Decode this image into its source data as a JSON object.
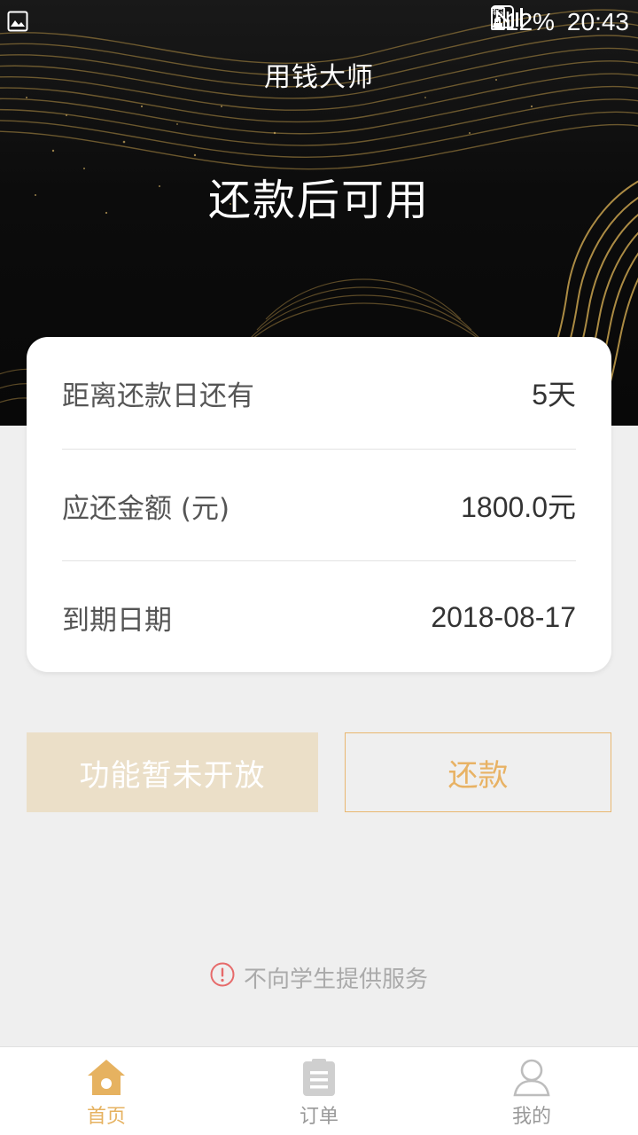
{
  "status_bar": {
    "battery_percent": "12%",
    "time": "20:43",
    "network": "4G",
    "icons": [
      "gallery-icon",
      "nfc-icon",
      "signal-icon",
      "battery-charging-icon"
    ]
  },
  "header": {
    "app_title": "用钱大师",
    "hero_heading": "还款后可用"
  },
  "info_card": {
    "rows": [
      {
        "label": "距离还款日还有",
        "value": "5天"
      },
      {
        "label": "应还金额 (元)",
        "value": "1800.0元"
      },
      {
        "label": "到期日期",
        "value": "2018-08-17"
      }
    ]
  },
  "actions": {
    "disabled_label": "功能暂未开放",
    "repay_label": "还款"
  },
  "notice": {
    "text": "不向学生提供服务",
    "icon": "warning-circle-icon"
  },
  "tab_bar": {
    "items": [
      {
        "label": "首页",
        "icon": "home-icon",
        "active": true
      },
      {
        "label": "订单",
        "icon": "clipboard-icon",
        "active": false
      },
      {
        "label": "我的",
        "icon": "user-icon",
        "active": false
      }
    ]
  },
  "colors": {
    "accent": "#e6b260",
    "disabled_button": "#ebdfc8",
    "hero_background": "#0d0d0d",
    "page_background": "#efefef",
    "warning": "#e66a6a"
  }
}
